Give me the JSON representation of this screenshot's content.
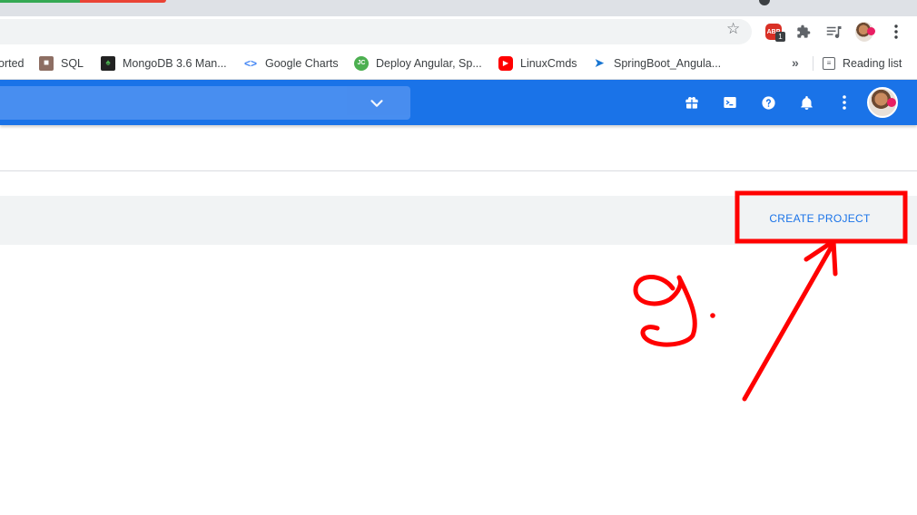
{
  "toolbar": {
    "extension_badge_count": "1",
    "adblock_label": "ABP"
  },
  "bookmarks": {
    "items": [
      {
        "label": "orted",
        "icon": "bookmark-icon"
      },
      {
        "label": "SQL",
        "icon": "sql-favicon"
      },
      {
        "label": "MongoDB 3.6 Man...",
        "icon": "mongodb-leaf-icon"
      },
      {
        "label": "Google Charts",
        "icon": "code-brackets-icon"
      },
      {
        "label": "Deploy Angular, Sp...",
        "icon": "deploy-favicon"
      },
      {
        "label": "LinuxCmds",
        "icon": "youtube-icon"
      },
      {
        "label": "SpringBoot_Angula...",
        "icon": "spring-favicon"
      }
    ],
    "more_label": "»",
    "reading_list_label": "Reading list"
  },
  "console": {
    "create_project_label": "CREATE PROJECT"
  },
  "annotation": {
    "step_text": "9.",
    "color": "#ff0000"
  },
  "colors": {
    "appbar": "#1a73e8",
    "action_bar": "#f1f3f4",
    "link_blue": "#1a73e8"
  }
}
